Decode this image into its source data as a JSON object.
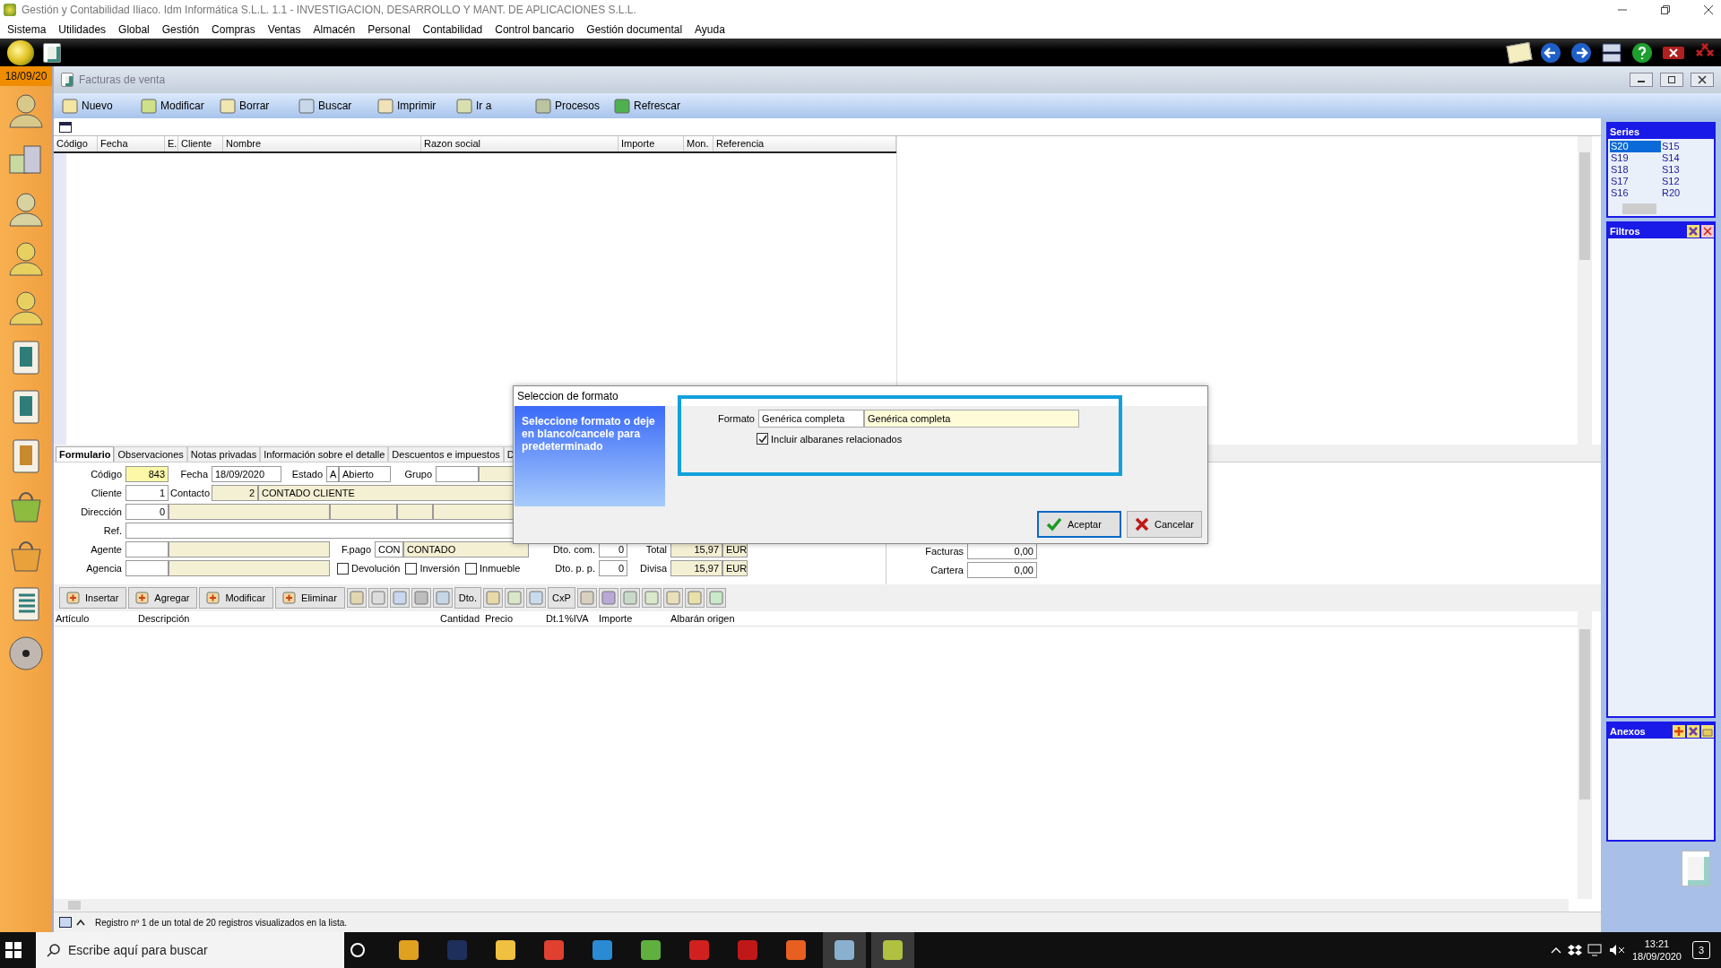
{
  "window": {
    "title": "Gestión y Contabilidad Iliaco. Idm Informática S.L.L. 1.1 - INVESTIGACION, DESARROLLO Y MANT. DE APLICACIONES S.L.L."
  },
  "menu": [
    "Sistema",
    "Utilidades",
    "Global",
    "Gestión",
    "Compras",
    "Ventas",
    "Almacén",
    "Personal",
    "Contabilidad",
    "Control bancario",
    "Gestión documental",
    "Ayuda"
  ],
  "date": "18/09/20",
  "subwindow": {
    "title": "Facturas de venta"
  },
  "toolbar": [
    "Nuevo",
    "Modificar",
    "Borrar",
    "Buscar",
    "Imprimir",
    "Ir a",
    "Procesos",
    "Refrescar"
  ],
  "table": {
    "columns": [
      "Código",
      "Fecha",
      "E.",
      "Cliente",
      "Nombre",
      "Razon social",
      "Importe",
      "Mon.",
      "Referencia"
    ]
  },
  "series": {
    "title": "Series",
    "items": [
      {
        "label": "S20",
        "selected": true
      },
      {
        "label": "S19",
        "selected": false
      },
      {
        "label": "S18",
        "selected": false
      },
      {
        "label": "S17",
        "selected": false
      },
      {
        "label": "S16",
        "selected": false
      },
      {
        "label": "S15",
        "selected": false
      },
      {
        "label": "S14",
        "selected": false
      },
      {
        "label": "S13",
        "selected": false
      },
      {
        "label": "S12",
        "selected": false
      },
      {
        "label": "R20",
        "selected": false
      }
    ]
  },
  "filters": {
    "title": "Filtros"
  },
  "attachments": {
    "title": "Anexos"
  },
  "form_tabs": [
    {
      "label": "Formulario",
      "selected": true
    },
    {
      "label": "Observaciones",
      "selected": false
    },
    {
      "label": "Notas privadas",
      "selected": false
    },
    {
      "label": "Información sobre el detalle",
      "selected": false
    },
    {
      "label": "Descuentos e impuestos",
      "selected": false
    },
    {
      "label": "D",
      "selected": false
    }
  ],
  "form": {
    "codigo_label": "Código",
    "codigo": "843",
    "fecha_label": "Fecha",
    "fecha": "18/09/2020",
    "estado_label": "Estado",
    "estado_code": "A",
    "estado": "Abierto",
    "grupo_label": "Grupo",
    "cliente_label": "Cliente",
    "cliente": "1",
    "contacto_label": "Contacto",
    "contacto_code": "2",
    "contacto": "CONTADO CLIENTE",
    "direccion_label": "Dirección",
    "direccion": "0",
    "ref_label": "Ref.",
    "agente_label": "Agente",
    "agencia_label": "Agencia",
    "fpago_label": "F.pago",
    "fpago_code": "CON",
    "fpago": "CONTADO",
    "checks": [
      {
        "label": "Devolución",
        "checked": false
      },
      {
        "label": "Inversión",
        "checked": false
      },
      {
        "label": "Inmueble",
        "checked": false
      }
    ],
    "dto_com_label": "Dto. com.",
    "dto_com": "0",
    "dto_pp_label": "Dto. p. p.",
    "dto_pp": "0",
    "total_label": "Total",
    "total": "15,97",
    "total_currency": "EUR",
    "divisa_label": "Divisa",
    "divisa": "15,97",
    "divisa_currency": "EUR",
    "facturas_label": "Facturas",
    "facturas": "0,00",
    "cartera_label": "Cartera",
    "cartera": "0,00"
  },
  "line_toolbar": [
    {
      "kind": "text",
      "label": "Insertar"
    },
    {
      "kind": "text",
      "label": "Agregar"
    },
    {
      "kind": "text",
      "label": "Modificar"
    },
    {
      "kind": "text",
      "label": "Eliminar"
    },
    {
      "kind": "icon"
    },
    {
      "kind": "icon"
    },
    {
      "kind": "icon"
    },
    {
      "kind": "icon"
    },
    {
      "kind": "icon"
    },
    {
      "kind": "short",
      "label": "Dto."
    },
    {
      "kind": "icon"
    },
    {
      "kind": "icon"
    },
    {
      "kind": "icon"
    },
    {
      "kind": "short",
      "label": "CxP"
    },
    {
      "kind": "icon"
    },
    {
      "kind": "icon"
    },
    {
      "kind": "icon"
    },
    {
      "kind": "icon"
    },
    {
      "kind": "icon"
    },
    {
      "kind": "icon"
    },
    {
      "kind": "icon"
    }
  ],
  "detail": {
    "columns": [
      "Artículo",
      "Descripción",
      "Cantidad",
      "Precio",
      "Dt.1",
      "%IVA",
      "Importe",
      "Albarán origen"
    ]
  },
  "status_bar": "Registro nº 1 de un total de 20 registros visualizados en la lista.",
  "dialog": {
    "title": "Seleccion de formato",
    "message": "Seleccione formato o deje en blanco/cancele para predeterminado",
    "format_label": "Formato",
    "format_code": "Genérica completa",
    "format_name": "Genérica completa",
    "include": {
      "label": "Incluir albaranes relacionados",
      "checked": true
    },
    "buttons": [
      "Aceptar",
      "Cancelar"
    ]
  },
  "taskbar": {
    "search_placeholder": "Escribe aquí para buscar",
    "time": "13:21",
    "date": "18/09/2020",
    "notifications": "3"
  }
}
